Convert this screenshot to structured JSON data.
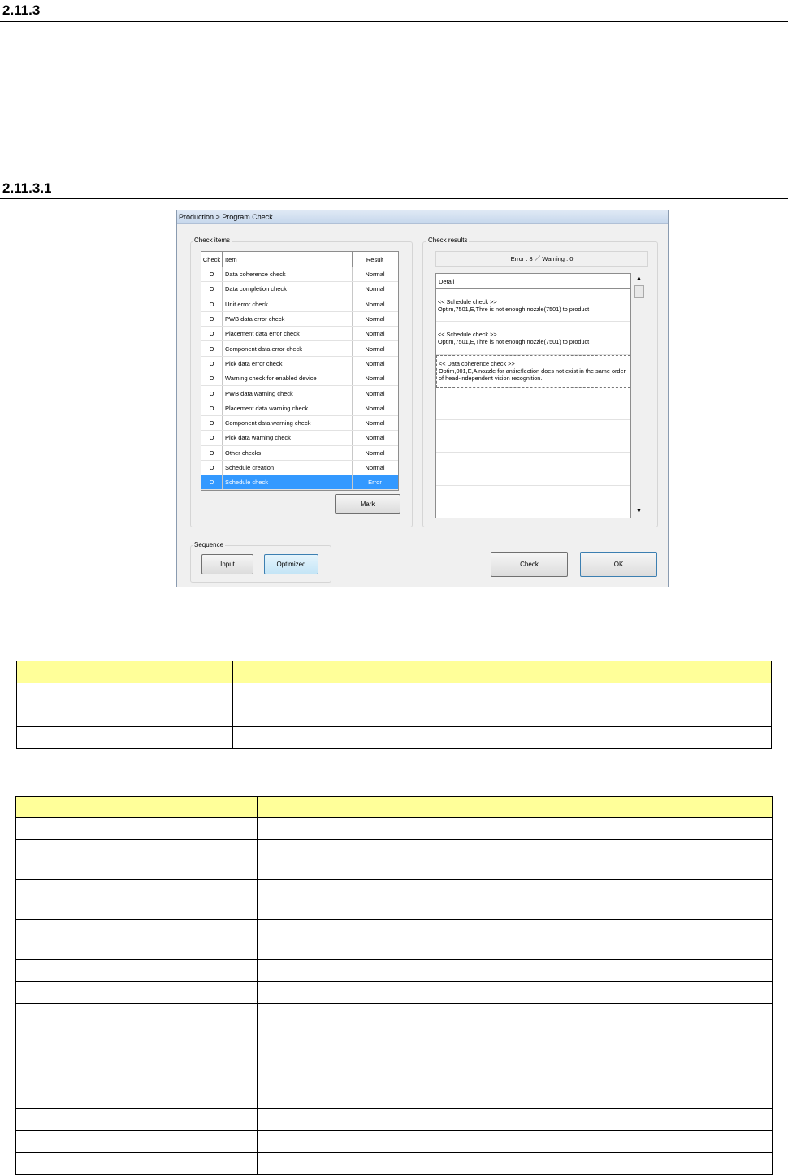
{
  "headings": {
    "section": "2.11.3",
    "subsection": "2.11.3.1"
  },
  "dialog": {
    "title": "Production > Program Check",
    "check_items_label": "Check items",
    "check_results_label": "Check results",
    "columns": {
      "check": "Check",
      "item": "Item",
      "result": "Result"
    },
    "rows": [
      {
        "check": "O",
        "item": "Data coherence check",
        "result": "Normal"
      },
      {
        "check": "O",
        "item": "Data completion check",
        "result": "Normal"
      },
      {
        "check": "O",
        "item": "Unit error check",
        "result": "Normal"
      },
      {
        "check": "O",
        "item": "PWB data error check",
        "result": "Normal"
      },
      {
        "check": "O",
        "item": "Placement data error check",
        "result": "Normal"
      },
      {
        "check": "O",
        "item": "Component data error check",
        "result": "Normal"
      },
      {
        "check": "O",
        "item": "Pick data error check",
        "result": "Normal"
      },
      {
        "check": "O",
        "item": "Warning check for enabled device",
        "result": "Normal"
      },
      {
        "check": "O",
        "item": "PWB data warning check",
        "result": "Normal"
      },
      {
        "check": "O",
        "item": "Placement data warning check",
        "result": "Normal"
      },
      {
        "check": "O",
        "item": "Component data warning check",
        "result": "Normal"
      },
      {
        "check": "O",
        "item": "Pick data warning check",
        "result": "Normal"
      },
      {
        "check": "O",
        "item": "Other checks",
        "result": "Normal"
      },
      {
        "check": "O",
        "item": "Schedule creation",
        "result": "Normal"
      },
      {
        "check": "O",
        "item": "Schedule check",
        "result": "Error"
      }
    ],
    "mark_button": "Mark",
    "summary": "Error : 3  ／  Warning : 0",
    "detail_header": "Detail",
    "details": [
      "<< Schedule check >>\nOptim,7501,E,Thre is not enough nozzle(7501) to product",
      "<< Schedule check >>\nOptim,7501,E,Thre is not enough nozzle(7501) to product",
      "<< Data coherence check >>\nOptim,001,E,A nozzle for antireflection does not exist in the same order of head-independent vision recognition.",
      "",
      "",
      ""
    ],
    "sequence_label": "Sequence",
    "input_button": "Input",
    "optimized_button": "Optimized",
    "check_button": "Check",
    "ok_button": "OK"
  }
}
